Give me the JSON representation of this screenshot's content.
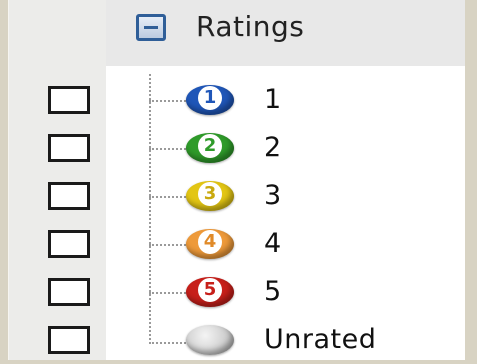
{
  "group": {
    "title": "Ratings",
    "collapse_icon": "minus-box-icon"
  },
  "ratings": [
    {
      "label": "1",
      "badge": "1",
      "color": "#1f56b8"
    },
    {
      "label": "2",
      "badge": "2",
      "color": "#2f9b2a"
    },
    {
      "label": "3",
      "badge": "3",
      "color": "#e3c614"
    },
    {
      "label": "4",
      "badge": "4",
      "color": "#ee9a3a"
    },
    {
      "label": "5",
      "badge": "5",
      "color": "#c71f1a"
    },
    {
      "label": "Unrated",
      "badge": "",
      "color": "#c9c9c9"
    }
  ]
}
